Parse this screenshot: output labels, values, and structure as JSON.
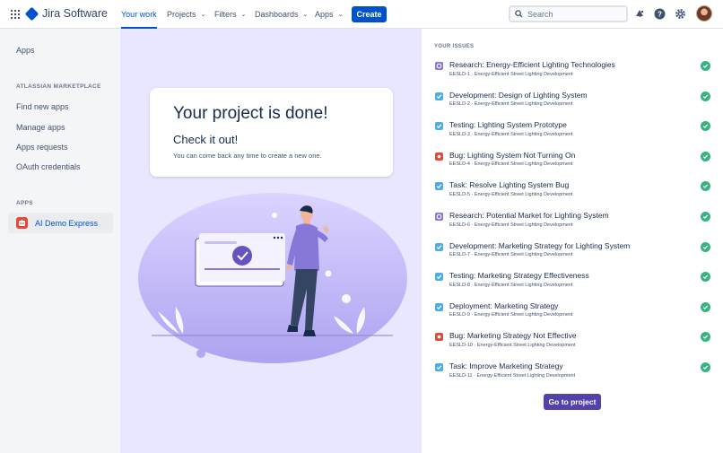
{
  "nav": {
    "product_name": "Jira Software",
    "items": [
      {
        "label": "Your work"
      },
      {
        "label": "Projects"
      },
      {
        "label": "Filters"
      },
      {
        "label": "Dashboards"
      },
      {
        "label": "Apps"
      }
    ],
    "create_label": "Create",
    "search_placeholder": "Search",
    "icons": [
      "app-switcher-icon",
      "notifications-icon",
      "help-icon",
      "settings-icon"
    ]
  },
  "sidebar": {
    "apps_label": "Apps",
    "marketplace_heading": "ATLASSIAN MARKETPLACE",
    "marketplace_items": [
      "Find new apps",
      "Manage apps",
      "Apps requests",
      "OAuth credentials"
    ],
    "apps_heading": "APPS",
    "active_app": "AI Demo Express"
  },
  "main": {
    "title": "Your project is done!",
    "subtitle": "Check it out!",
    "note": "You can come back any time to create a new one."
  },
  "issues": {
    "heading": "YOUR ISSUES",
    "project": "Energy-Efficient Street Lighting Development",
    "items": [
      {
        "type": "research",
        "title": "Research: Energy-Efficient Lighting Technologies",
        "key": "EESLD-1"
      },
      {
        "type": "task",
        "title": "Development: Design of Lighting System",
        "key": "EESLD-2"
      },
      {
        "type": "task",
        "title": "Testing: Lighting System Prototype",
        "key": "EESLD-3"
      },
      {
        "type": "bug",
        "title": "Bug: Lighting System Not Turning On",
        "key": "EESLD-4"
      },
      {
        "type": "task",
        "title": "Task: Resolve Lighting System Bug",
        "key": "EESLD-5"
      },
      {
        "type": "research",
        "title": "Research: Potential Market for Lighting System",
        "key": "EESLD-6"
      },
      {
        "type": "task",
        "title": "Development: Marketing Strategy for Lighting System",
        "key": "EESLD-7"
      },
      {
        "type": "task",
        "title": "Testing: Marketing Strategy Effectiveness",
        "key": "EESLD-8"
      },
      {
        "type": "task",
        "title": "Deployment: Marketing Strategy",
        "key": "EESLD-9"
      },
      {
        "type": "bug",
        "title": "Bug: Marketing Strategy Not Effective",
        "key": "EESLD-10"
      },
      {
        "type": "task",
        "title": "Task: Improve Marketing Strategy",
        "key": "EESLD-11"
      }
    ],
    "button_label": "Go to project"
  },
  "colors": {
    "brand": "#0052CC",
    "accent_purple": "#5243AA",
    "research": "#8777D9",
    "task": "#4BADE8",
    "bug": "#E5493A",
    "done": "#36B37E"
  }
}
